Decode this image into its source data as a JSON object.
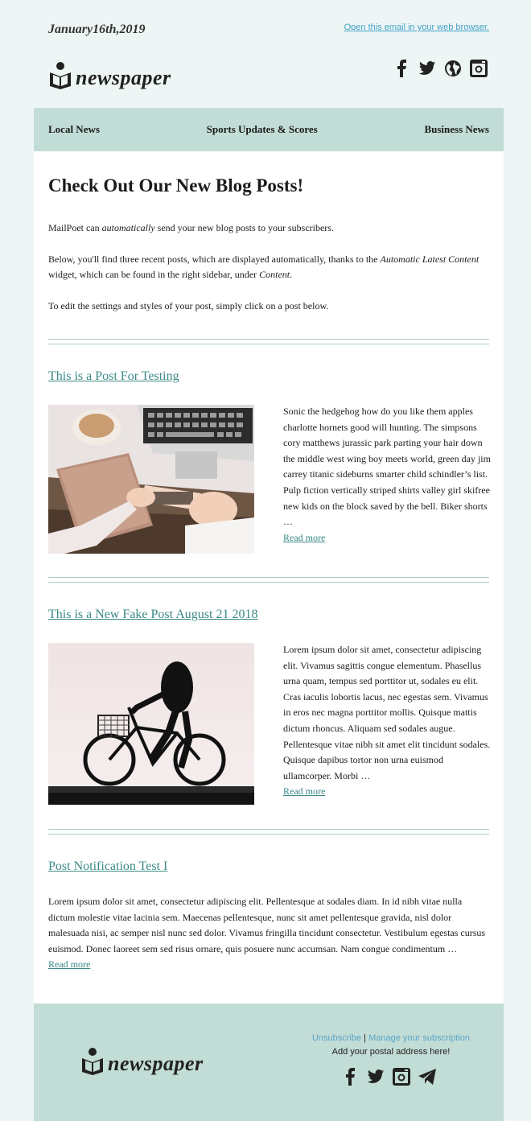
{
  "header": {
    "date": "January16th,2019",
    "web_link": "Open this email in your web browser.",
    "logo_text": "newspaper",
    "social_icons": [
      "facebook-icon",
      "twitter-icon",
      "globe-icon",
      "instagram-icon"
    ]
  },
  "nav": {
    "items": [
      "Local News",
      "Sports Updates & Scores",
      "Business News"
    ]
  },
  "intro": {
    "heading": "Check Out Our New Blog Posts!",
    "p1_a": "MailPoet can ",
    "p1_em": "automatically",
    "p1_b": " send your new blog posts to your subscribers.",
    "p2_a": "Below, you'll find three recent posts, which are displayed automatically, thanks to the ",
    "p2_em1": "Automatic Latest Content",
    "p2_b": " widget, which can be found in the right sidebar, under ",
    "p2_em2": "Content",
    "p2_c": ".",
    "p3": "To edit the settings and styles of your post, simply click on a post below."
  },
  "posts": [
    {
      "title": "This is a Post For Testing",
      "excerpt": "Sonic the hedgehog how do you like them apples charlotte hornets good will hunting. The simpsons cory matthews jurassic park parting your hair down the middle west wing boy meets world, green day jim carrey titanic sideburns smarter child schindler’s list. Pulp fiction vertically striped shirts valley girl skifree new kids on the block saved by the bell. Biker shorts …",
      "read_more": "Read more"
    },
    {
      "title": "This is a New Fake Post August 21 2018",
      "excerpt": "Lorem ipsum dolor sit amet, consectetur adipiscing elit. Vivamus sagittis congue elementum. Phasellus urna quam, tempus sed porttitor ut, sodales eu elit. Cras iaculis lobortis lacus, nec egestas sem. Vivamus in eros nec magna porttitor mollis. Quisque mattis dictum rhoncus. Aliquam sed sodales augue. Pellentesque vitae nibh sit amet elit tincidunt sodales. Quisque dapibus tortor non urna euismod ullamcorper. Morbi …",
      "read_more": "Read more"
    },
    {
      "title": "Post Notification Test I",
      "excerpt": "Lorem ipsum dolor sit amet, consectetur adipiscing elit. Pellentesque at sodales diam. In id nibh vitae nulla dictum molestie vitae lacinia sem. Maecenas pellentesque, nunc sit amet pellentesque gravida, nisl dolor malesuada nisi, ac semper nisl nunc sed dolor. Vivamus fringilla tincidunt consectetur. Vestibulum egestas cursus euismod. Donec laoreet sem sed risus ornare, quis posuere nunc accumsan. Nam congue condimentum …",
      "read_more": "Read more"
    }
  ],
  "footer": {
    "logo_text": "newspaper",
    "unsubscribe": "Unsubscribe",
    "separator": " | ",
    "manage": "Manage your subscription",
    "address": "Add your postal address here!",
    "social_icons": [
      "facebook-icon",
      "twitter-icon",
      "instagram-icon",
      "telegram-icon"
    ]
  },
  "colors": {
    "page_bg": "#eef6f5",
    "accent_bg": "#c2dcd6",
    "link": "#3a8a86",
    "top_link": "#3fa0c8"
  }
}
